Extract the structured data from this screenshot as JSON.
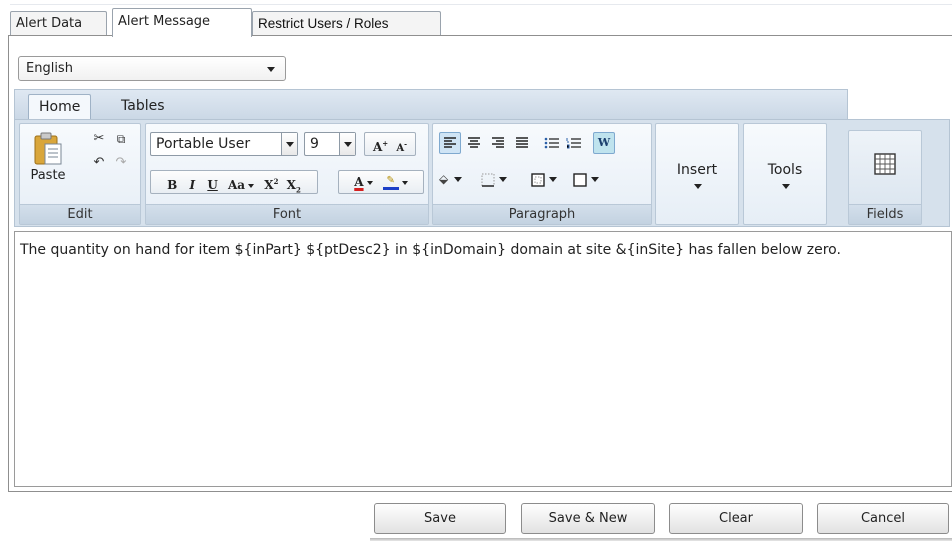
{
  "outer_tabs": [
    {
      "label": "Alert Data",
      "active": false
    },
    {
      "label": "Alert Message",
      "active": true
    },
    {
      "label": "Restrict Users / Roles",
      "active": false
    }
  ],
  "language_select": {
    "value": "English"
  },
  "ribbon": {
    "tabs": [
      {
        "label": "Home",
        "active": true
      },
      {
        "label": "Tables",
        "active": false
      }
    ],
    "groups": {
      "edit": {
        "label": "Edit",
        "paste_label": "Paste"
      },
      "font": {
        "label": "Font",
        "font_family": "Portable User",
        "font_size": "9",
        "bold": "B",
        "italic": "I",
        "underline": "U",
        "change_case": "Aa",
        "superscript": "X",
        "subscript": "X",
        "font_color": "A",
        "grow": "A",
        "shrink": "A"
      },
      "paragraph": {
        "label": "Paragraph",
        "wrap_letter": "W"
      },
      "insert": {
        "label": "Insert"
      },
      "tools": {
        "label": "Tools"
      },
      "fields": {
        "label": "Fields"
      }
    }
  },
  "editor": {
    "text": "The quantity on hand for item ${inPart} ${ptDesc2} in ${inDomain} domain at site &{inSite} has fallen below zero."
  },
  "actions": {
    "save": "Save",
    "save_new": "Save & New",
    "clear": "Clear",
    "cancel": "Cancel"
  },
  "colors": {
    "ribbon_bg": "#d6e1ec",
    "selected_align": "#cfe4f5",
    "font_color_bar": "#d42020",
    "highlight_bar": "#1c3fc7"
  }
}
